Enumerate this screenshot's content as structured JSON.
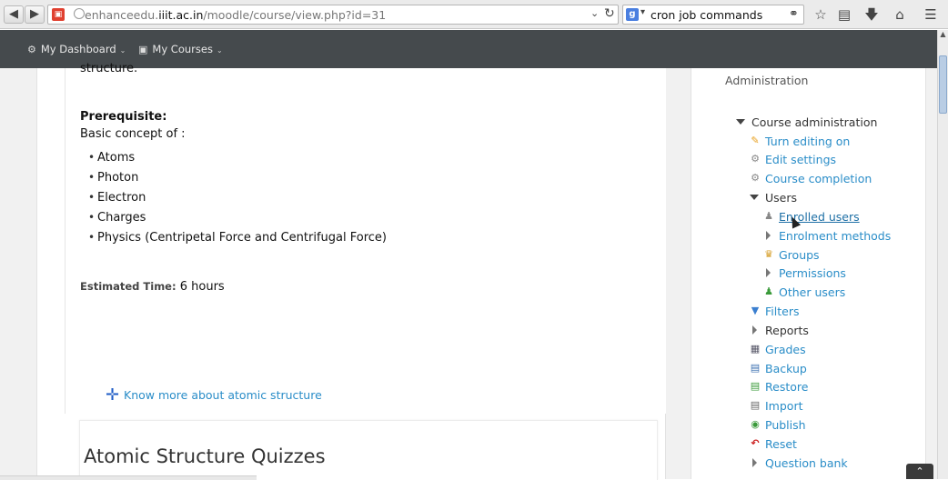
{
  "browser": {
    "url_prefix": "enhanceedu.",
    "url_domain": "iiit.ac.in",
    "url_path": "/moodle/course/view.php?id=31",
    "search_engine": "g",
    "search_query": "cron job commands"
  },
  "navbar": {
    "dashboard": "My Dashboard",
    "courses": "My Courses"
  },
  "course": {
    "intro_tail": "structure.",
    "prerequisite_heading": "Prerequisite:",
    "prerequisite_intro": "Basic concept of :",
    "prerequisites": [
      "Atoms",
      "Photon",
      "Electron",
      "Charges",
      "Physics (Centripetal Force and Centrifugal Force)"
    ],
    "estimated_label": "Estimated Time:",
    "estimated_value": "6 hours",
    "know_more_link": "Know more about atomic structure",
    "quiz_section_title": "Atomic Structure Quizzes"
  },
  "admin": {
    "title": "Administration",
    "course_admin": "Course administration",
    "turn_editing": "Turn editing on",
    "edit_settings": "Edit settings",
    "course_completion": "Course completion",
    "users": "Users",
    "enrolled_users": "Enrolled users",
    "enrolment_methods": "Enrolment methods",
    "groups": "Groups",
    "permissions": "Permissions",
    "other_users": "Other users",
    "filters": "Filters",
    "reports": "Reports",
    "grades": "Grades",
    "backup": "Backup",
    "restore": "Restore",
    "import": "Import",
    "publish": "Publish",
    "reset": "Reset",
    "question_bank": "Question bank"
  },
  "colors": {
    "link": "#2a8dc8",
    "navbar": "#454a4d"
  }
}
